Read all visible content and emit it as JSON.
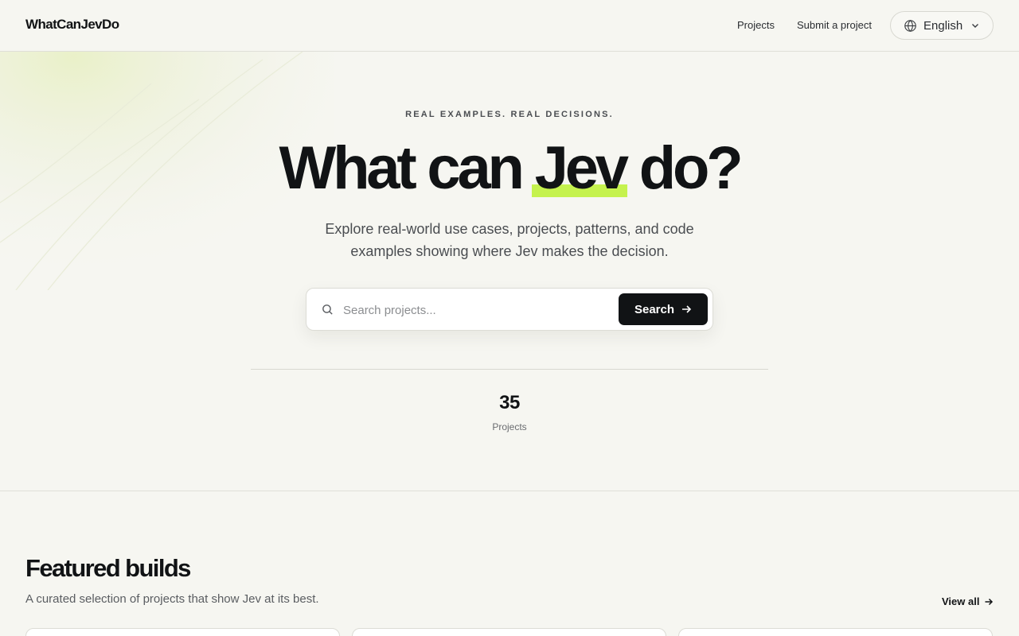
{
  "header": {
    "brand": "WhatCanJevDo",
    "nav": [
      "Projects",
      "Submit a project"
    ],
    "language": {
      "label": "English",
      "icon": "globe-icon",
      "chevron": "chevron-down-icon"
    }
  },
  "hero": {
    "eyebrow": "REAL EXAMPLES. REAL DECISIONS.",
    "headline_before": "What can ",
    "headline_highlight": "Jev",
    "headline_after": " do?",
    "highlight_color": "#c5f24e",
    "subtitle": "Explore real-world use cases, projects, patterns, and code examples showing where Jev makes the decision.",
    "search": {
      "placeholder": "Search projects...",
      "button_label": "Search",
      "icon": "search-icon"
    },
    "stat": {
      "value": "35",
      "label": "Projects"
    }
  },
  "featured": {
    "title": "Featured builds",
    "subtitle": "A curated selection of projects that show Jev at its best.",
    "view_all": "View all"
  },
  "colors": {
    "background": "#f6f6f1",
    "text": "#111315",
    "accent": "#c5f24e",
    "button": "#111315"
  }
}
